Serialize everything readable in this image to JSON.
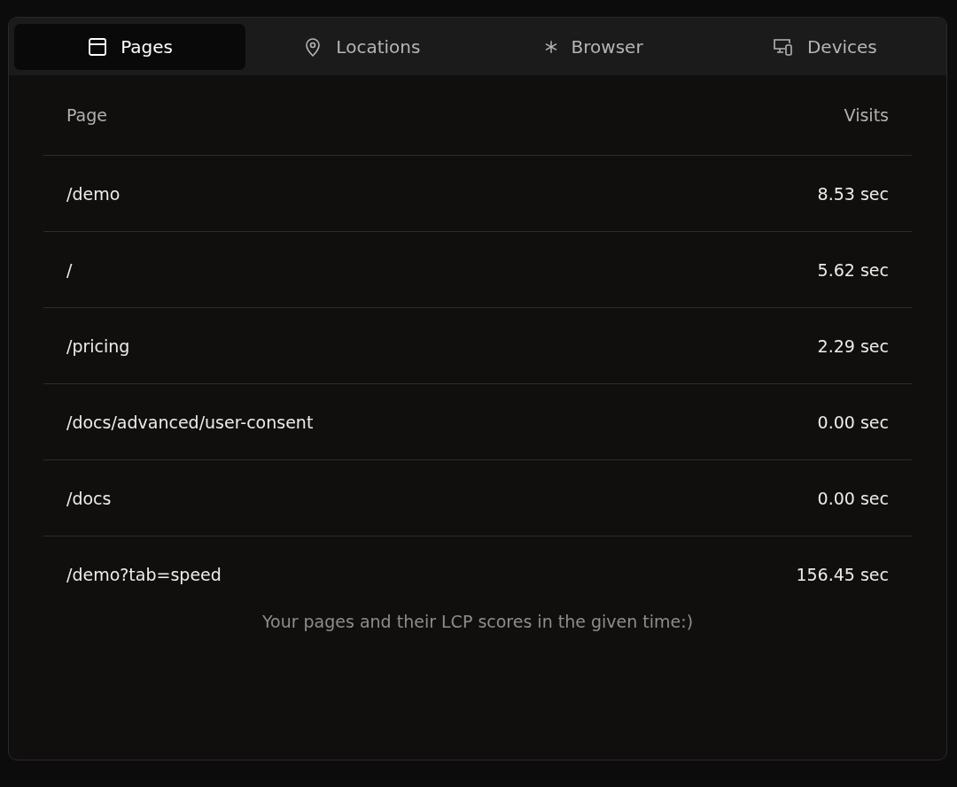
{
  "tabs": [
    {
      "label": "Pages",
      "selected": true
    },
    {
      "label": "Locations",
      "selected": false
    },
    {
      "label": "Browser",
      "selected": false
    },
    {
      "label": "Devices",
      "selected": false
    }
  ],
  "table": {
    "columns": [
      "Page",
      "Visits"
    ],
    "rows": [
      {
        "page": "/demo",
        "visits": "8.53 sec"
      },
      {
        "page": "/",
        "visits": "5.62 sec"
      },
      {
        "page": "/pricing",
        "visits": "2.29 sec"
      },
      {
        "page": "/docs/advanced/user-consent",
        "visits": "0.00 sec"
      },
      {
        "page": "/docs",
        "visits": "0.00 sec"
      },
      {
        "page": "/demo?tab=speed",
        "visits": "156.45 sec"
      }
    ]
  },
  "footer": "Your pages and their LCP scores in the given time:)"
}
